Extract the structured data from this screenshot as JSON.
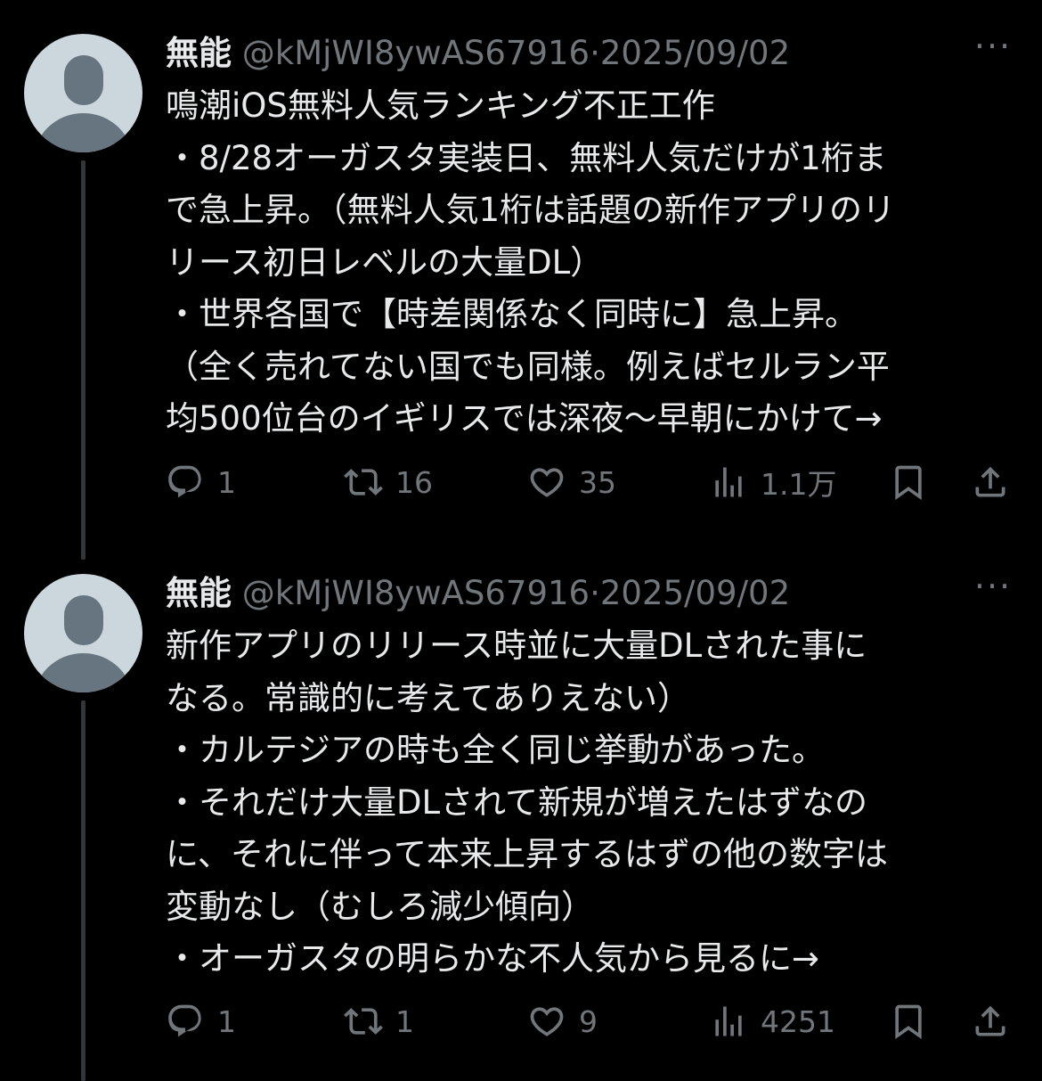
{
  "tweets": [
    {
      "name": "無能",
      "handle": "@kMjWI8ywAS67916",
      "dot": "·",
      "date": "2025/09/02",
      "more": "···",
      "text": "鳴潮iOS無料人気ランキング不正工作\n・8/28オーガスタ実装日、無料人気だけが1桁ま\nで急上昇。（無料人気1桁は話題の新作アプリのリ\nリース初日レベルの大量DL）\n・世界各国で【時差関係なく同時に】急上昇。\n（全く売れてない国でも同様。例えばセルラン平\n均500位台のイギリスでは深夜〜早朝にかけて→",
      "replies": "1",
      "retweets": "16",
      "likes": "35",
      "views": "1.1万"
    },
    {
      "name": "無能",
      "handle": "@kMjWI8ywAS67916",
      "dot": "·",
      "date": "2025/09/02",
      "more": "···",
      "text": "新作アプリのリリース時並に大量DLされた事に\nなる。常識的に考えてありえない）\n・カルテジアの時も全く同じ挙動があった。\n・それだけ大量DLされて新規が増えたはずなの\nに、それに伴って本来上昇するはずの他の数字は\n変動なし（むしろ減少傾向）\n・オーガスタの明らかな不人気から見るに→",
      "replies": "1",
      "retweets": "1",
      "likes": "9",
      "views": "4251"
    }
  ],
  "icons": {
    "reply": "reply-icon",
    "retweet": "retweet-icon",
    "like": "heart-icon",
    "views": "views-icon",
    "bookmark": "bookmark-icon",
    "share": "share-icon"
  }
}
